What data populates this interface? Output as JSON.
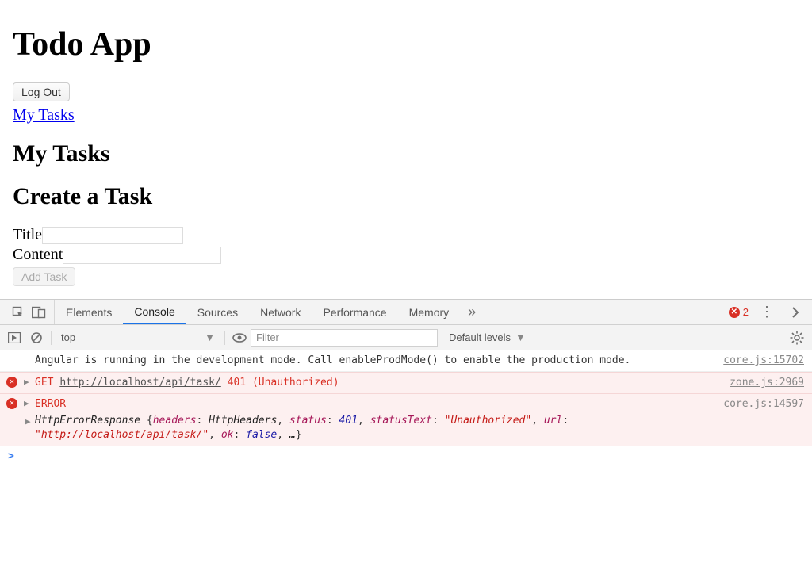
{
  "app": {
    "title": "Todo App",
    "logout_label": "Log Out",
    "nav_link": "My Tasks",
    "tasks_heading": "My Tasks",
    "create_heading": "Create a Task",
    "title_label": "Title",
    "content_label": "Content",
    "add_task_label": "Add Task"
  },
  "devtools": {
    "tabs": {
      "elements": "Elements",
      "console": "Console",
      "sources": "Sources",
      "network": "Network",
      "performance": "Performance",
      "memory": "Memory"
    },
    "error_count": "2",
    "context": "top",
    "filter_placeholder": "Filter",
    "levels": "Default levels"
  },
  "console": {
    "log1": {
      "text": "Angular is running in the development mode. Call enableProdMode() to enable the production mode.",
      "source": "core.js:15702"
    },
    "log2": {
      "method": "GET",
      "url": "http://localhost/api/task/",
      "status": "401 (Unauthorized)",
      "source": "zone.js:2969"
    },
    "log3": {
      "label": "ERROR",
      "source": "core.js:14597",
      "class": "HttpErrorResponse",
      "headers_key": "headers",
      "headers_val": "HttpHeaders",
      "status_key": "status",
      "status_val": "401",
      "statusText_key": "statusText",
      "statusText_val": "\"Unauthorized\"",
      "url_key": "url",
      "url_val": "\"http://localhost/api/task/\"",
      "ok_key": "ok",
      "ok_val": "false",
      "ellipsis": "…"
    },
    "prompt": ">"
  }
}
